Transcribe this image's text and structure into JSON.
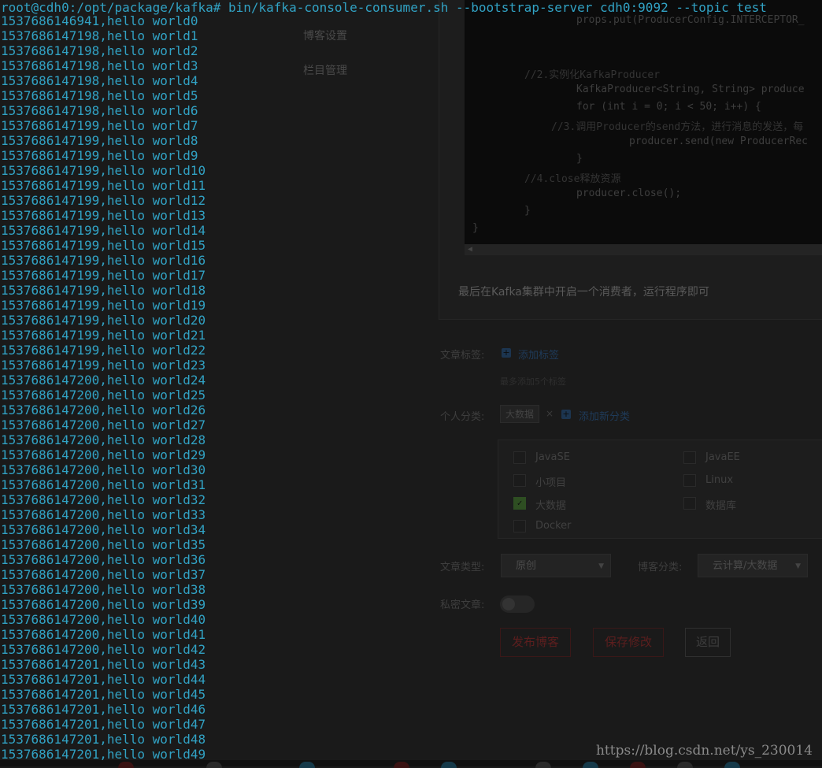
{
  "terminal": {
    "prompt": "root@cdh0:/opt/package/kafka#",
    "command": "bin/kafka-console-consumer.sh --bootstrap-server cdh0:9092 --topic test",
    "lines": [
      "1537686146941,hello world0",
      "1537686147198,hello world1",
      "1537686147198,hello world2",
      "1537686147198,hello world3",
      "1537686147198,hello world4",
      "1537686147198,hello world5",
      "1537686147198,hello world6",
      "1537686147199,hello world7",
      "1537686147199,hello world8",
      "1537686147199,hello world9",
      "1537686147199,hello world10",
      "1537686147199,hello world11",
      "1537686147199,hello world12",
      "1537686147199,hello world13",
      "1537686147199,hello world14",
      "1537686147199,hello world15",
      "1537686147199,hello world16",
      "1537686147199,hello world17",
      "1537686147199,hello world18",
      "1537686147199,hello world19",
      "1537686147199,hello world20",
      "1537686147199,hello world21",
      "1537686147199,hello world22",
      "1537686147199,hello world23",
      "1537686147200,hello world24",
      "1537686147200,hello world25",
      "1537686147200,hello world26",
      "1537686147200,hello world27",
      "1537686147200,hello world28",
      "1537686147200,hello world29",
      "1537686147200,hello world30",
      "1537686147200,hello world31",
      "1537686147200,hello world32",
      "1537686147200,hello world33",
      "1537686147200,hello world34",
      "1537686147200,hello world35",
      "1537686147200,hello world36",
      "1537686147200,hello world37",
      "1537686147200,hello world38",
      "1537686147200,hello world39",
      "1537686147200,hello world40",
      "1537686147200,hello world41",
      "1537686147200,hello world42",
      "1537686147201,hello world43",
      "1537686147201,hello world44",
      "1537686147201,hello world45",
      "1537686147201,hello world46",
      "1537686147201,hello world47",
      "1537686147201,hello world48",
      "1537686147201,hello world49"
    ],
    "text_color": "#31a2c4"
  },
  "watermark": "https://blog.csdn.net/ys_230014",
  "background_page": {
    "nav": [
      "博客设置",
      "栏目管理"
    ],
    "code_lines": [
      "props.put(ProducerConfig.INTERCEPTOR_",
      "//2.实例化KafkaProducer",
      "KafkaProducer<String, String> produce",
      "for (int i = 0; i < 50; i++) {",
      "//3.调用Producer的send方法，进行消息的发送，每",
      "producer.send(new ProducerRec",
      "}",
      "//4.close释放资源",
      "producer.close();",
      "}",
      "}"
    ],
    "closing_text": "最后在Kafka集群中开启一个消费者，运行程序即可",
    "tags_label": "文章标签:",
    "add_tag": "添加标签",
    "tags_hint": "最多添加5个标签",
    "category_label": "个人分类:",
    "selected_category": "大数据",
    "remove_mark": "×",
    "add_category": "添加新分类",
    "categories": [
      {
        "name": "JavaSE",
        "checked": false
      },
      {
        "name": "JavaEE",
        "checked": false
      },
      {
        "name": "小项目",
        "checked": false
      },
      {
        "name": "Linux",
        "checked": false
      },
      {
        "name": "大数据",
        "checked": true
      },
      {
        "name": "数据库",
        "checked": false
      },
      {
        "name": "Docker",
        "checked": false
      }
    ],
    "type_label": "文章类型:",
    "type_value": "原创",
    "blog_cat_label": "博客分类:",
    "blog_cat_value": "云计算/大数据",
    "private_label": "私密文章:",
    "buttons": {
      "publish": "发布博客",
      "save": "保存修改",
      "back": "返回"
    }
  }
}
